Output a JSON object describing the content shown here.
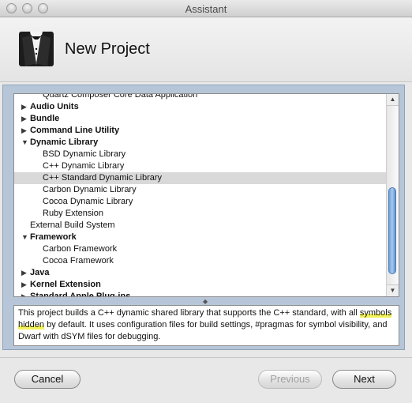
{
  "window": {
    "title": "Assistant"
  },
  "header": {
    "heading": "New Project",
    "icon": "tuxedo-icon"
  },
  "list": {
    "items": [
      {
        "label": "Quartz Composer Core Data Application",
        "level": 1,
        "type": "leaf"
      },
      {
        "label": "Audio Units",
        "level": 0,
        "type": "collapsed"
      },
      {
        "label": "Bundle",
        "level": 0,
        "type": "collapsed"
      },
      {
        "label": "Command Line Utility",
        "level": 0,
        "type": "collapsed"
      },
      {
        "label": "Dynamic Library",
        "level": 0,
        "type": "expanded"
      },
      {
        "label": "BSD Dynamic Library",
        "level": 1,
        "type": "leaf"
      },
      {
        "label": "C++ Dynamic Library",
        "level": 1,
        "type": "leaf"
      },
      {
        "label": "C++ Standard Dynamic Library",
        "level": 1,
        "type": "leaf",
        "selected": true
      },
      {
        "label": "Carbon Dynamic Library",
        "level": 1,
        "type": "leaf"
      },
      {
        "label": "Cocoa Dynamic Library",
        "level": 1,
        "type": "leaf"
      },
      {
        "label": "Ruby Extension",
        "level": 1,
        "type": "leaf"
      },
      {
        "label": "External Build System",
        "level": 0,
        "type": "leaf"
      },
      {
        "label": "Framework",
        "level": 0,
        "type": "expanded"
      },
      {
        "label": "Carbon Framework",
        "level": 1,
        "type": "leaf"
      },
      {
        "label": "Cocoa Framework",
        "level": 1,
        "type": "leaf"
      },
      {
        "label": "Java",
        "level": 0,
        "type": "collapsed"
      },
      {
        "label": "Kernel Extension",
        "level": 0,
        "type": "collapsed"
      },
      {
        "label": "Standard Apple Plug-ins",
        "level": 0,
        "type": "collapsed"
      }
    ]
  },
  "description": {
    "before": "This project builds a C++ dynamic shared library that supports the C++ standard, with all ",
    "highlight": "symbols hidden",
    "after": " by default. It uses configuration files for build settings, #pragmas for symbol visibility, and Dwarf with dSYM files for debugging."
  },
  "buttons": {
    "cancel": "Cancel",
    "previous": "Previous",
    "next": "Next"
  },
  "colors": {
    "highlight": "#f3f35a",
    "selection": "#d9d9d9",
    "frame": "#b6c6d8"
  }
}
